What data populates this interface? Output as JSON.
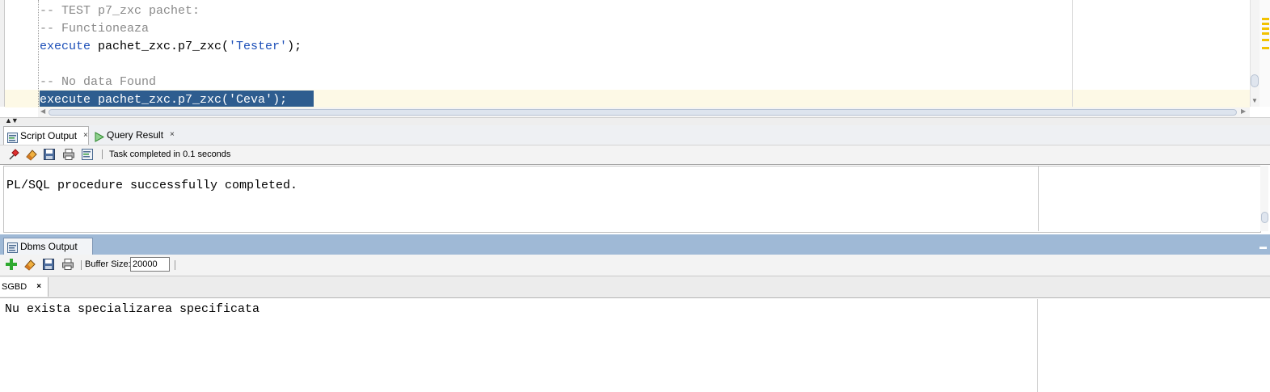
{
  "editor": {
    "lines": [
      {
        "type": "comment",
        "text": "-- TEST p7_zxc pachet:"
      },
      {
        "type": "comment",
        "text": "-- Functioneaza"
      },
      {
        "keyword": "execute",
        "mid": " pachet_zxc.p7_zxc(",
        "string": "'Tester'",
        "end": ");"
      },
      {
        "type": "comment",
        "text": "-- No data Found"
      },
      {
        "keyword": "execute",
        "mid": " pachet_zxc.p7_zxc(",
        "string": "'Ceva'",
        "end": ");"
      }
    ]
  },
  "script_output": {
    "tabs": [
      {
        "label": "Script Output",
        "close": "×",
        "icon": "script-output-icon"
      },
      {
        "label": "Query Result",
        "close": "×",
        "icon": "run-triangle-icon"
      }
    ],
    "toolbar_icons": [
      "pin-icon",
      "eraser-icon",
      "save-icon",
      "print-icon",
      "export-icon"
    ],
    "status": "Task completed in 0.1 seconds",
    "output_text": "PL/SQL procedure successfully completed."
  },
  "dbms_output": {
    "tab_label": "Dbms Output",
    "toolbar_icons": [
      "add-connection-icon",
      "eraser-icon",
      "save-icon",
      "print-icon"
    ],
    "buffer_label": "Buffer Size:",
    "buffer_value": "20000",
    "connection_tab": "SGBD",
    "connection_close": "×",
    "output_text": "Nu exista specializarea specificata"
  },
  "colors": {
    "selection": "#2e5d8f",
    "keyword": "#1c4fb8",
    "comment": "#8a8a8a",
    "dbms_header": "#9fb9d6"
  }
}
